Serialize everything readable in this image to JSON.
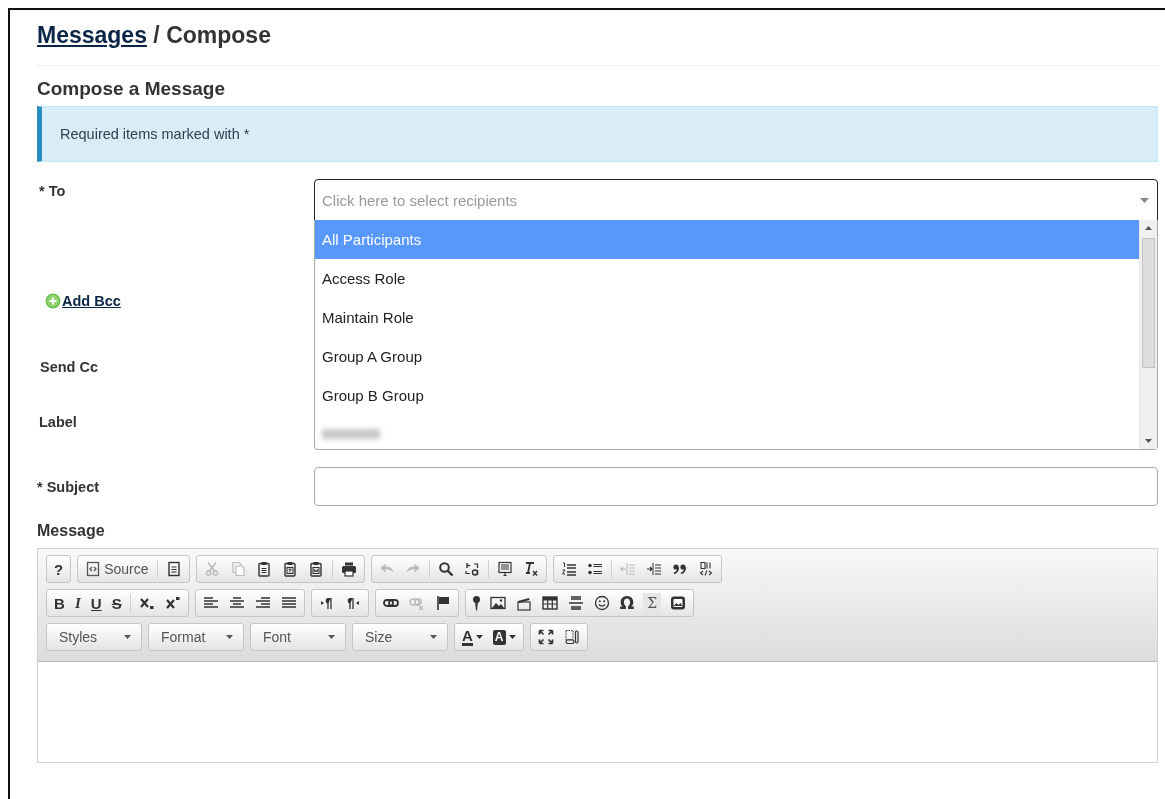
{
  "breadcrumb": {
    "link": "Messages",
    "current": "/ Compose"
  },
  "section_title": "Compose a Message",
  "alert": "Required items marked with *",
  "form": {
    "to_label": "* To",
    "to_placeholder": "Click here to select recipients",
    "add_bcc": "Add Bcc",
    "send_cc_label": "Send Cc",
    "label_label": "Label",
    "subject_label": "* Subject",
    "message_label": "Message"
  },
  "recipient_options": [
    {
      "kind": "option",
      "label": "All Participants",
      "selected": true
    },
    {
      "kind": "option",
      "label": "Access Role",
      "selected": false
    },
    {
      "kind": "option",
      "label": "Maintain Role",
      "selected": false
    },
    {
      "kind": "option",
      "label": "Group A Group",
      "selected": false
    },
    {
      "kind": "option",
      "label": "Group B Group",
      "selected": false
    },
    {
      "kind": "blurred",
      "selected": false
    }
  ],
  "toolbar": [
    [
      {
        "runs": [
          [
            {
              "kind": "help",
              "text": "?",
              "disabled": false
            }
          ]
        ]
      },
      {
        "runs": [
          [
            {
              "kind": "source",
              "text": "Source",
              "disabled": false
            }
          ],
          [
            {
              "kind": "preview",
              "disabled": false
            }
          ]
        ]
      },
      {
        "runs": [
          [
            {
              "kind": "cut",
              "disabled": true
            },
            {
              "kind": "copy",
              "disabled": true
            },
            {
              "kind": "paste",
              "disabled": false
            },
            {
              "kind": "paste-text",
              "disabled": false
            },
            {
              "kind": "paste-word",
              "disabled": false
            }
          ],
          [
            {
              "kind": "print",
              "disabled": false
            }
          ]
        ]
      },
      {
        "runs": [
          [
            {
              "kind": "undo",
              "disabled": true
            },
            {
              "kind": "redo",
              "disabled": true
            }
          ],
          [
            {
              "kind": "find",
              "disabled": false
            },
            {
              "kind": "replace",
              "disabled": false
            }
          ],
          [
            {
              "kind": "select-all",
              "disabled": false
            },
            {
              "kind": "remove-format",
              "disabled": false
            }
          ]
        ]
      },
      {
        "runs": [
          [
            {
              "kind": "numbered-list",
              "disabled": false
            },
            {
              "kind": "bulleted-list",
              "disabled": false
            }
          ],
          [
            {
              "kind": "outdent",
              "disabled": true
            },
            {
              "kind": "indent",
              "disabled": false
            },
            {
              "kind": "blockquote",
              "disabled": false
            },
            {
              "kind": "div",
              "disabled": false
            }
          ]
        ]
      }
    ],
    [
      {
        "runs": [
          [
            {
              "kind": "bold",
              "text": "B",
              "disabled": false
            },
            {
              "kind": "italic",
              "text": "I",
              "disabled": false
            },
            {
              "kind": "underline",
              "text": "U",
              "disabled": false
            },
            {
              "kind": "strike",
              "text": "S",
              "disabled": false
            }
          ],
          [
            {
              "kind": "subscript",
              "disabled": false
            },
            {
              "kind": "superscript",
              "disabled": false
            }
          ]
        ]
      },
      {
        "runs": [
          [
            {
              "kind": "align-left",
              "disabled": false
            },
            {
              "kind": "align-center",
              "disabled": false
            },
            {
              "kind": "align-right",
              "disabled": false
            },
            {
              "kind": "justify",
              "disabled": false
            }
          ]
        ]
      },
      {
        "runs": [
          [
            {
              "kind": "ltr",
              "disabled": false
            },
            {
              "kind": "rtl",
              "disabled": false
            }
          ]
        ]
      },
      {
        "runs": [
          [
            {
              "kind": "link",
              "disabled": false
            },
            {
              "kind": "unlink",
              "disabled": true
            },
            {
              "kind": "anchor",
              "disabled": false
            }
          ]
        ]
      },
      {
        "runs": [
          [
            {
              "kind": "placeholder",
              "disabled": false
            },
            {
              "kind": "image",
              "disabled": false
            },
            {
              "kind": "video",
              "disabled": false
            },
            {
              "kind": "table",
              "disabled": false
            },
            {
              "kind": "hr",
              "disabled": false
            },
            {
              "kind": "smiley",
              "disabled": false
            },
            {
              "kind": "omega",
              "text": "Ω",
              "disabled": false
            },
            {
              "kind": "sigma",
              "text": "Σ",
              "disabled": false
            },
            {
              "kind": "iframe",
              "disabled": false
            }
          ]
        ]
      }
    ],
    [
      {
        "runs": [
          [
            {
              "kind": "combo",
              "text": "Styles",
              "disabled": false
            }
          ]
        ]
      },
      {
        "runs": [
          [
            {
              "kind": "combo",
              "text": "Format",
              "disabled": false
            }
          ]
        ]
      },
      {
        "runs": [
          [
            {
              "kind": "combo",
              "text": "Font",
              "disabled": false
            }
          ]
        ]
      },
      {
        "runs": [
          [
            {
              "kind": "combo",
              "text": "Size",
              "disabled": false
            }
          ]
        ]
      },
      {
        "runs": [
          [
            {
              "kind": "text-color",
              "text": "A",
              "disabled": false
            },
            {
              "kind": "bg-color",
              "text": "A",
              "disabled": false
            }
          ]
        ]
      },
      {
        "runs": [
          [
            {
              "kind": "maximize",
              "disabled": false
            },
            {
              "kind": "show-blocks",
              "disabled": false
            }
          ]
        ]
      }
    ]
  ]
}
